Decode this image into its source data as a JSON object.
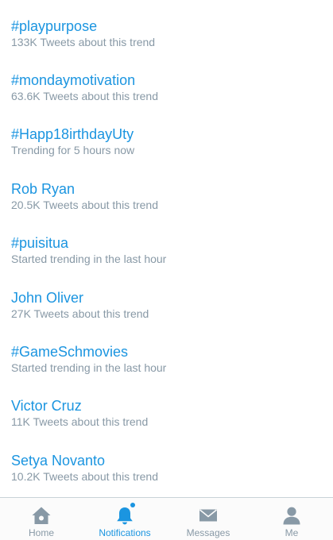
{
  "trends": [
    {
      "name": "#playpurpose",
      "meta": "133K Tweets about this trend"
    },
    {
      "name": "#mondaymotivation",
      "meta": "63.6K Tweets about this trend"
    },
    {
      "name": "#Happ18irthdayUty",
      "meta": "Trending for 5 hours now"
    },
    {
      "name": "Rob Ryan",
      "meta": "20.5K Tweets about this trend"
    },
    {
      "name": "#puisitua",
      "meta": "Started trending in the last hour"
    },
    {
      "name": "John Oliver",
      "meta": "27K Tweets about this trend"
    },
    {
      "name": "#GameSchmovies",
      "meta": "Started trending in the last hour"
    },
    {
      "name": "Victor Cruz",
      "meta": "11K Tweets about this trend"
    },
    {
      "name": "Setya Novanto",
      "meta": "10.2K Tweets about this trend"
    }
  ],
  "tabbar": {
    "tabs": [
      {
        "label": "Home",
        "icon": "home-icon"
      },
      {
        "label": "Notifications",
        "icon": "bell-icon",
        "active": true,
        "has_unread_dot": true
      },
      {
        "label": "Messages",
        "icon": "envelope-icon"
      },
      {
        "label": "Me",
        "icon": "person-icon"
      }
    ]
  },
  "colors": {
    "accent": "#1b95e0",
    "secondary_text": "#8899a6",
    "icon_inactive": "#8899a6"
  }
}
